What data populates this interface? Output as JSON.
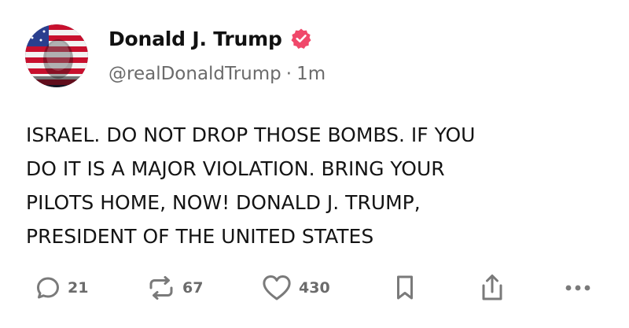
{
  "post": {
    "display_name": "Donald J. Trump",
    "handle": "@realDonaldTrump",
    "separator": "·",
    "time": "1m",
    "body_lines": [
      "ISRAEL. DO NOT DROP THOSE BOMBS. IF YOU",
      "DO IT IS A MAJOR VIOLATION. BRING YOUR",
      "PILOTS HOME, NOW!  DONALD J. TRUMP,",
      "PRESIDENT OF THE UNITED STATES"
    ]
  },
  "actions": {
    "replies": "21",
    "reposts": "67",
    "likes": "430"
  },
  "icons": {
    "verified": "verified-badge-icon",
    "reply": "reply-bubble-icon",
    "repost": "repost-icon",
    "like": "heart-icon",
    "bookmark": "bookmark-icon",
    "share": "share-icon",
    "more": "more-horizontal-icon"
  },
  "colors": {
    "verified_badge": "#f0486a",
    "text_primary": "#111111",
    "text_secondary": "#6b6b6b",
    "icon": "#7a7a7a"
  }
}
